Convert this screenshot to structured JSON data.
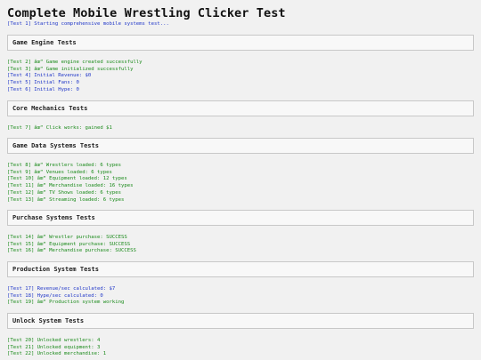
{
  "page": {
    "title": "Complete Mobile Wrestling Clicker Test",
    "intro": {
      "text": "[Test 1] Starting comprehensive mobile systems test...",
      "status": "info"
    }
  },
  "sections": [
    {
      "title": "Game Engine Tests",
      "lines": [
        {
          "text": "[Test 2] âœ“ Game engine created successfully",
          "status": "ok"
        },
        {
          "text": "[Test 3] âœ“ Game initialized successfully",
          "status": "ok"
        },
        {
          "text": "[Test 4] Initial Revenue: $0",
          "status": "info"
        },
        {
          "text": "[Test 5] Initial Fans: 0",
          "status": "info"
        },
        {
          "text": "[Test 6] Initial Hype: 0",
          "status": "info"
        }
      ]
    },
    {
      "title": "Core Mechanics Tests",
      "lines": [
        {
          "text": "[Test 7] âœ“ Click works: gained $1",
          "status": "ok"
        }
      ]
    },
    {
      "title": "Game Data Systems Tests",
      "lines": [
        {
          "text": "[Test 8] âœ“ Wrestlers loaded: 6 types",
          "status": "ok"
        },
        {
          "text": "[Test 9] âœ“ Venues loaded: 6 types",
          "status": "ok"
        },
        {
          "text": "[Test 10] âœ“ Equipment loaded: 12 types",
          "status": "ok"
        },
        {
          "text": "[Test 11] âœ“ Merchandise loaded: 16 types",
          "status": "ok"
        },
        {
          "text": "[Test 12] âœ“ TV Shows loaded: 6 types",
          "status": "ok"
        },
        {
          "text": "[Test 13] âœ“ Streaming loaded: 6 types",
          "status": "ok"
        }
      ]
    },
    {
      "title": "Purchase Systems Tests",
      "lines": [
        {
          "text": "[Test 14] âœ“ Wrestler purchase: SUCCESS",
          "status": "ok"
        },
        {
          "text": "[Test 15] âœ“ Equipment purchase: SUCCESS",
          "status": "ok"
        },
        {
          "text": "[Test 16] âœ“ Merchandise purchase: SUCCESS",
          "status": "ok"
        }
      ]
    },
    {
      "title": "Production System Tests",
      "lines": [
        {
          "text": "[Test 17] Revenue/sec calculated: $7",
          "status": "info"
        },
        {
          "text": "[Test 18] Hype/sec calculated: 0",
          "status": "info"
        },
        {
          "text": "[Test 19] âœ“ Production system working",
          "status": "ok"
        }
      ]
    },
    {
      "title": "Unlock System Tests",
      "lines": [
        {
          "text": "[Test 20] Unlocked wrestlers: 4",
          "status": "ok"
        },
        {
          "text": "[Test 21] Unlocked equipment: 3",
          "status": "ok"
        },
        {
          "text": "[Test 22] Unlocked merchandise: 1",
          "status": "ok"
        }
      ]
    }
  ]
}
